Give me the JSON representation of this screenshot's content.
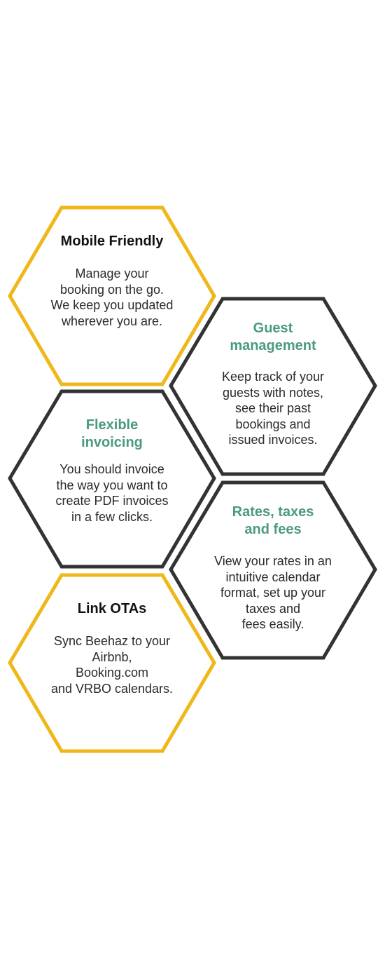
{
  "colors": {
    "yellow_border": "#f0b719",
    "dark_border": "#333333",
    "green_title": "#4a9a7e",
    "dark_title": "#111111"
  },
  "features": [
    {
      "title": "Mobile Friendly",
      "description": "Manage your\nbooking on the go.\nWe keep you updated\nwherever you are.",
      "border": "yellow"
    },
    {
      "title": "Guest\nmanagement",
      "description": "Keep track of your\nguests with notes,\nsee their past\nbookings and\nissued invoices.",
      "border": "dark"
    },
    {
      "title": "Flexible\ninvoicing",
      "description": "You should invoice\nthe way you want to\ncreate PDF invoices\nin a few clicks.",
      "border": "dark"
    },
    {
      "title": "Rates, taxes\nand fees",
      "description": "View your rates in an\nintuitive calendar\nformat, set up your\ntaxes and\nfees easily.",
      "border": "dark"
    },
    {
      "title": "Link OTAs",
      "description": "Sync Beehaz to your\nAirbnb,\nBooking.com\nand VRBO calendars.",
      "border": "yellow"
    }
  ]
}
